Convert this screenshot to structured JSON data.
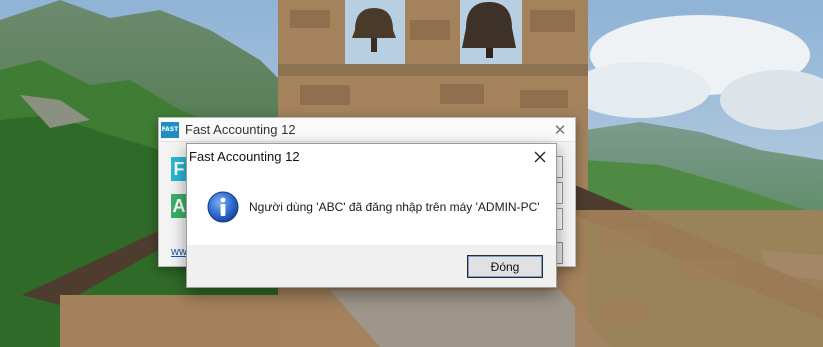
{
  "back_window": {
    "title": "Fast Accounting 12",
    "logo_text": "FAST",
    "brand_letter_1": "F",
    "brand_letter_2": "A",
    "link_text": "ww",
    "close_icon": "close-icon"
  },
  "dialog": {
    "title": "Fast Accounting 12",
    "icon": "info-icon",
    "message": "Người dùng 'ABC' đã đăng nhập trên máy 'ADMIN-PC'",
    "ok_label": "Đóng",
    "close_icon": "close-icon"
  },
  "colors": {
    "accent_blue": "#1f5fbf",
    "dialog_footer": "#f0f0f0",
    "window_bg": "#f4f4f4"
  }
}
